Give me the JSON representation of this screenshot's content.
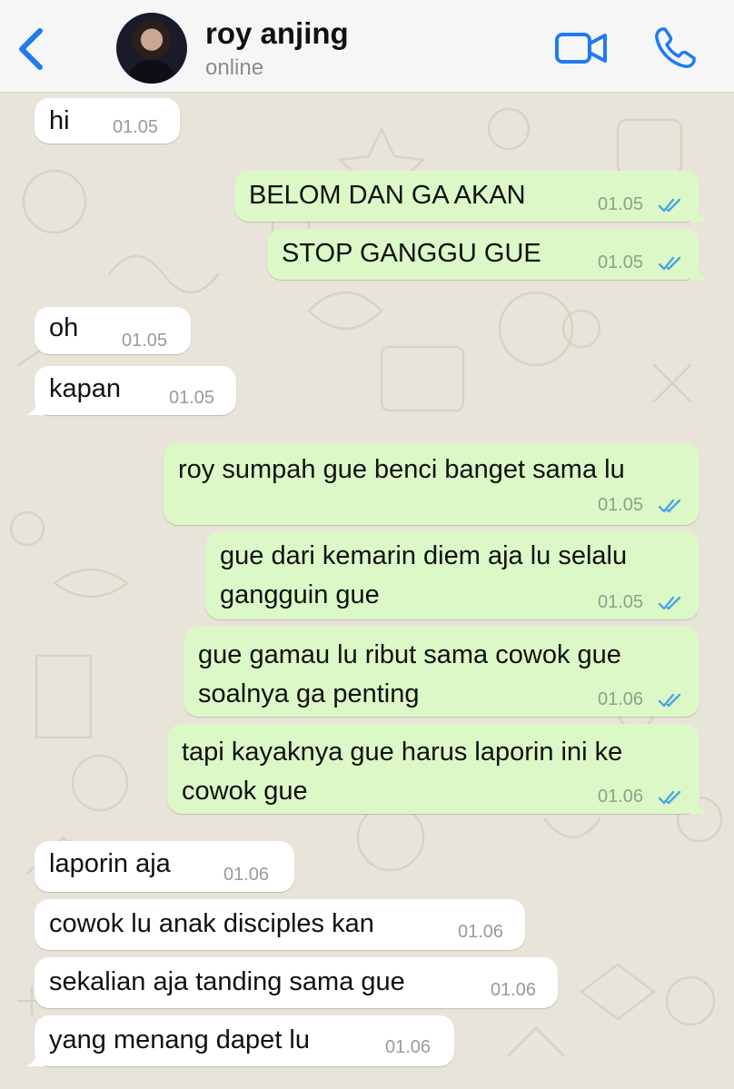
{
  "header": {
    "contact_name": "roy anjing",
    "status": "online",
    "accent_color": "#1f7cf0"
  },
  "messages": [
    {
      "direction": "in",
      "lines": [
        "hi"
      ],
      "time": "01.05"
    },
    {
      "direction": "out",
      "lines": [
        "BELOM DAN GA AKAN"
      ],
      "time": "01.05",
      "read": true
    },
    {
      "direction": "out",
      "lines": [
        "STOP GANGGU GUE"
      ],
      "time": "01.05",
      "read": true
    },
    {
      "direction": "in",
      "lines": [
        "oh"
      ],
      "time": "01.05"
    },
    {
      "direction": "in",
      "lines": [
        "kapan"
      ],
      "time": "01.05"
    },
    {
      "direction": "out",
      "lines": [
        "roy sumpah gue benci banget sama lu"
      ],
      "time": "01.05",
      "read": true
    },
    {
      "direction": "out",
      "lines": [
        "gue dari kemarin diem aja lu selalu",
        "gangguin gue"
      ],
      "time": "01.05",
      "read": true
    },
    {
      "direction": "out",
      "lines": [
        "gue gamau lu ribut sama cowok gue",
        "soalnya ga penting"
      ],
      "time": "01.06",
      "read": true
    },
    {
      "direction": "out",
      "lines": [
        "tapi kayaknya gue harus laporin ini ke",
        "cowok gue"
      ],
      "time": "01.06",
      "read": true
    },
    {
      "direction": "in",
      "lines": [
        "laporin aja"
      ],
      "time": "01.06"
    },
    {
      "direction": "in",
      "lines": [
        "cowok lu anak disciples kan"
      ],
      "time": "01.06"
    },
    {
      "direction": "in",
      "lines": [
        "sekalian aja tanding sama gue"
      ],
      "time": "01.06"
    },
    {
      "direction": "in",
      "lines": [
        "yang menang dapet lu"
      ],
      "time": "01.06"
    }
  ],
  "icons": {
    "back": "chevron-left-icon",
    "video": "video-camera-icon",
    "call": "phone-icon",
    "read_receipt": "double-check-icon"
  }
}
